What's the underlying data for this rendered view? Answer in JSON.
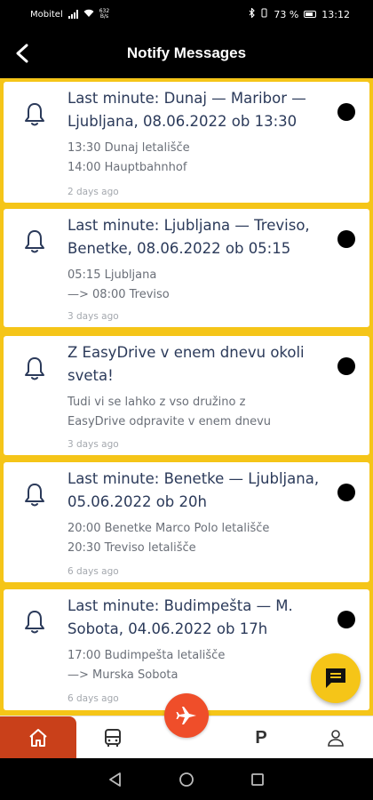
{
  "status_bar": {
    "carrier": "Mobitel",
    "net_speed_value": "632",
    "net_speed_unit": "B/s",
    "battery": "73 %",
    "time": "13:12"
  },
  "header": {
    "title": "Notify Messages"
  },
  "notifications": [
    {
      "title": "Last minute: Dunaj — Maribor — Ljubljana, 08.06.2022 ob 13:30",
      "body_lines": [
        "13:30 Dunaj letališče",
        "14:00 Hauptbahnhof"
      ],
      "time": "2 days ago"
    },
    {
      "title": "Last minute: Ljubljana — Treviso, Benetke, 08.06.2022 ob 05:15",
      "body_lines": [
        "05:15 Ljubljana",
        "—> 08:00 Treviso"
      ],
      "time": "3 days ago"
    },
    {
      "title": "Z EasyDrive v enem dnevu okoli sveta!",
      "body_lines": [
        "Tudi vi se lahko z vso družino z",
        "EasyDrive odpravite v enem dnevu"
      ],
      "time": "3 days ago"
    },
    {
      "title": "Last minute: Benetke — Ljubljana, 05.06.2022 ob 20h",
      "body_lines": [
        "20:00 Benetke Marco Polo letališče",
        "20:30 Treviso letališče"
      ],
      "time": "6 days ago"
    },
    {
      "title": "Last minute: Budimpešta — M. Sobota, 04.06.2022 ob 17h",
      "body_lines": [
        "17:00 Budimpešta letališče",
        "—> Murska Sobota"
      ],
      "time": "6 days ago"
    }
  ],
  "bottom_nav": {
    "parking_label": "P"
  },
  "icons": {
    "back": "chevron-left-icon",
    "bell": "bell-icon",
    "chat": "chat-icon",
    "home": "home-icon",
    "bus": "bus-icon",
    "plane": "airplane-icon",
    "profile": "person-icon"
  },
  "colors": {
    "accent_yellow": "#f5c518",
    "home_active": "#c9401a",
    "plane_fab": "#ef4e2a",
    "title_text": "#2b3a5a"
  }
}
